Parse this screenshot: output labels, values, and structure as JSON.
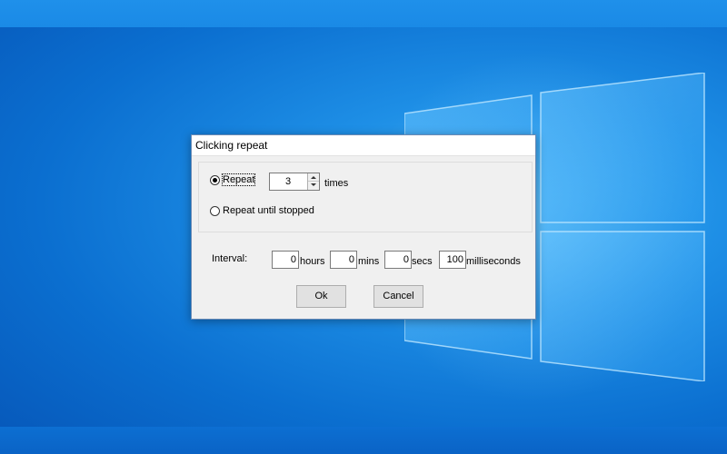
{
  "dialog": {
    "title": "Clicking repeat",
    "repeat": {
      "label": "Repeat",
      "selected": true,
      "count": "3",
      "suffix": "times"
    },
    "repeat_until_stopped": {
      "label": "Repeat until stopped",
      "selected": false
    },
    "interval": {
      "label": "Interval:",
      "hours": "0",
      "hours_label": "hours",
      "mins": "0",
      "mins_label": "mins",
      "secs": "0",
      "secs_label": "secs",
      "milliseconds": "100",
      "milliseconds_label": "milliseconds"
    },
    "buttons": {
      "ok": "Ok",
      "cancel": "Cancel"
    }
  },
  "colors": {
    "desktop_blue": "#0b6fd0",
    "dialog_bg": "#f0f0f0",
    "button_bg": "#e1e1e1"
  }
}
